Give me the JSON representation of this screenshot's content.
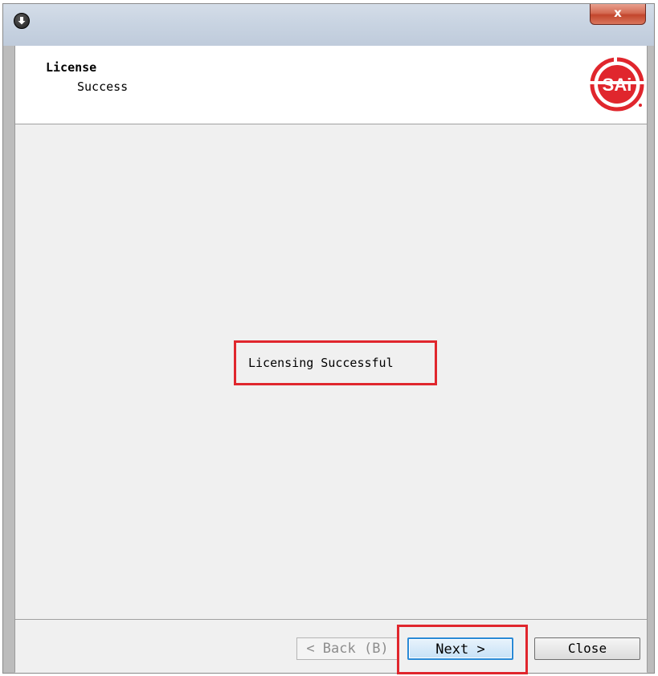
{
  "titlebar": {
    "close_glyph": "x",
    "app_icon": "download-arrow-icon"
  },
  "header": {
    "title": "License",
    "subtitle": "Success",
    "logo_text": "SAi",
    "logo_color": "#e0262d"
  },
  "main": {
    "status_message": "Licensing Successful",
    "highlight_color": "#e0262d"
  },
  "footer": {
    "back_label": "< Back (B)",
    "next_label": "Next >",
    "close_label": "Close"
  }
}
